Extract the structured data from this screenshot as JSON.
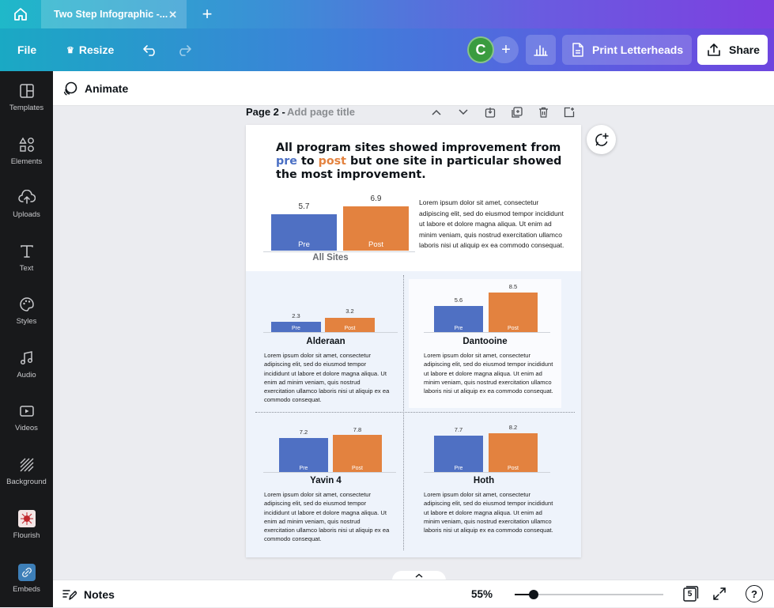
{
  "tabbar": {
    "tab_title": "Two Step Infographic -...",
    "close_glyph": "✕",
    "new_tab_glyph": "+"
  },
  "toolbar": {
    "file_label": "File",
    "resize_label": "Resize",
    "avatar_initial": "C",
    "add_glyph": "+",
    "print_label": "Print Letterheads",
    "share_label": "Share"
  },
  "sidebar": {
    "items": [
      {
        "label": "Templates",
        "icon": "templates-icon"
      },
      {
        "label": "Elements",
        "icon": "elements-icon"
      },
      {
        "label": "Uploads",
        "icon": "uploads-icon"
      },
      {
        "label": "Text",
        "icon": "text-icon"
      },
      {
        "label": "Styles",
        "icon": "styles-icon"
      },
      {
        "label": "Audio",
        "icon": "audio-icon"
      },
      {
        "label": "Videos",
        "icon": "videos-icon"
      },
      {
        "label": "Background",
        "icon": "background-icon"
      },
      {
        "label": "Flourish",
        "icon": "flourish-icon"
      },
      {
        "label": "Embeds",
        "icon": "embeds-icon"
      }
    ]
  },
  "contextbar": {
    "animate_label": "Animate"
  },
  "page_header": {
    "label": "Page 2 -",
    "placeholder": "Add page title"
  },
  "design": {
    "headline": {
      "part1": "All program sites showed improvement from ",
      "pre": "pre",
      "part2": " to ",
      "post": "post",
      "part3": " but one site in particular showed the most improvement."
    },
    "all_sites": {
      "name": "All Sites",
      "pre_value": "5.7",
      "post_value": "6.9",
      "pre_label": "Pre",
      "post_label": "Post",
      "text": "Lorem ipsum dolor sit amet, consectetur adipiscing elit, sed do eiusmod tempor incididunt ut labore et dolore magna aliqua. Ut enim ad minim veniam, quis nostrud exercitation ullamco laboris nisi ut aliquip ex ea commodo consequat."
    },
    "sites": [
      {
        "name": "Alderaan",
        "pre_value": "2.3",
        "post_value": "3.2",
        "pre_label": "Pre",
        "post_label": "Post",
        "text": "Lorem ipsum dolor sit amet, consectetur adipiscing elit, sed do eiusmod tempor incididunt ut labore et dolore magna aliqua. Ut enim ad minim veniam, quis nostrud exercitation ullamco laboris nisi ut aliquip ex ea commodo consequat."
      },
      {
        "name": "Dantooine",
        "pre_value": "5.6",
        "post_value": "8.5",
        "pre_label": "Pre",
        "post_label": "Post",
        "text": "Lorem ipsum dolor sit amet, consectetur adipiscing elit, sed do eiusmod tempor incididunt ut labore et dolore magna aliqua. Ut enim ad minim veniam, quis nostrud exercitation ullamco laboris nisi ut aliquip ex ea commodo consequat."
      },
      {
        "name": "Yavin 4",
        "pre_value": "7.2",
        "post_value": "7.8",
        "pre_label": "Pre",
        "post_label": "Post",
        "text": "Lorem ipsum dolor sit amet, consectetur adipiscing elit, sed do eiusmod tempor incididunt ut labore et dolore magna aliqua. Ut enim ad minim veniam, quis nostrud exercitation ullamco laboris nisi ut aliquip ex ea commodo consequat."
      },
      {
        "name": "Hoth",
        "pre_value": "7.7",
        "post_value": "8.2",
        "pre_label": "Pre",
        "post_label": "Post",
        "text": "Lorem ipsum dolor sit amet, consectetur adipiscing elit, sed do eiusmod tempor incididunt ut labore et dolore magna aliqua. Ut enim ad minim veniam, quis nostrud exercitation ullamco laboris nisi ut aliquip ex ea commodo consequat."
      }
    ],
    "colors": {
      "pre": "#4f70c3",
      "post": "#e3823f"
    }
  },
  "bottombar": {
    "notes_label": "Notes",
    "zoom_label": "55%",
    "zoom_fraction": 0.13,
    "page_count": "5",
    "help_glyph": "?"
  }
}
